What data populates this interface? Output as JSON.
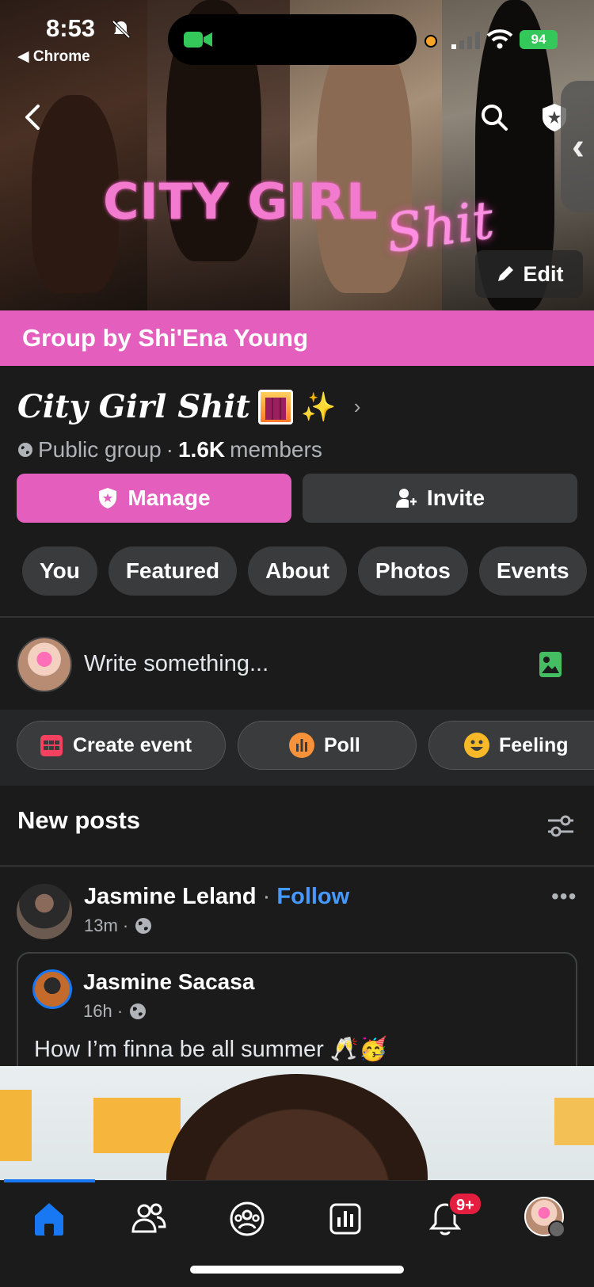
{
  "status_bar": {
    "time": "8:53",
    "back_app": "◀ Chrome",
    "battery": "94"
  },
  "cover": {
    "title": "CITY GIRL",
    "script": "Shit",
    "edit_label": "Edit"
  },
  "banner": {
    "text": "Group by Shi'Ena Young"
  },
  "group": {
    "name": "City Girl Shit",
    "privacy": "Public group",
    "separator": "·",
    "member_count": "1.6K",
    "members_label": "members"
  },
  "buttons": {
    "manage": "Manage",
    "invite": "Invite"
  },
  "tabs": [
    "You",
    "Featured",
    "About",
    "Photos",
    "Events"
  ],
  "composer": {
    "placeholder": "Write something..."
  },
  "actions": {
    "create_event": "Create event",
    "poll": "Poll",
    "feeling": "Feeling"
  },
  "section": {
    "title": "New posts"
  },
  "post": {
    "author": "Jasmine Leland",
    "separator": "·",
    "follow": "Follow",
    "time": "13m ·",
    "more": "•••",
    "shared": {
      "author": "Jasmine Sacasa",
      "time": "16h ·",
      "caption": "How I’m finna be all summer 🥂🥳"
    }
  },
  "bottom_nav": {
    "notification_badge": "9+"
  },
  "colors": {
    "accent_pink": "#e45fbd",
    "link_blue": "#4599ff",
    "fb_blue": "#1877f2",
    "badge_red": "#e41e3f"
  }
}
